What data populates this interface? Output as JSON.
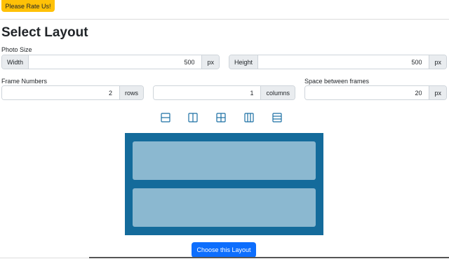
{
  "rate_button": "Please Rate Us!",
  "title": "Select Layout",
  "photo_size": {
    "label": "Photo Size",
    "width_label": "Width",
    "width_value": "500",
    "width_unit": "px",
    "height_label": "Height",
    "height_value": "500",
    "height_unit": "px"
  },
  "frame_numbers": {
    "label": "Frame Numbers",
    "rows_value": "2",
    "rows_unit": "rows",
    "columns_value": "1",
    "columns_unit": "columns"
  },
  "spacing": {
    "label": "Space between frames",
    "value": "20",
    "unit": "px"
  },
  "layout_icons": [
    "layout-rows-2-icon",
    "layout-columns-2-icon",
    "layout-grid-2x2-icon",
    "layout-columns-3-icon",
    "layout-rows-3-icon"
  ],
  "colors": {
    "rate_button": "#ffc107",
    "primary_button": "#0d6efd",
    "preview_background": "#146b9b",
    "preview_frame": "#8bb8d0",
    "icon": "#1a6fa3"
  },
  "choose_button": "Choose this Layout"
}
